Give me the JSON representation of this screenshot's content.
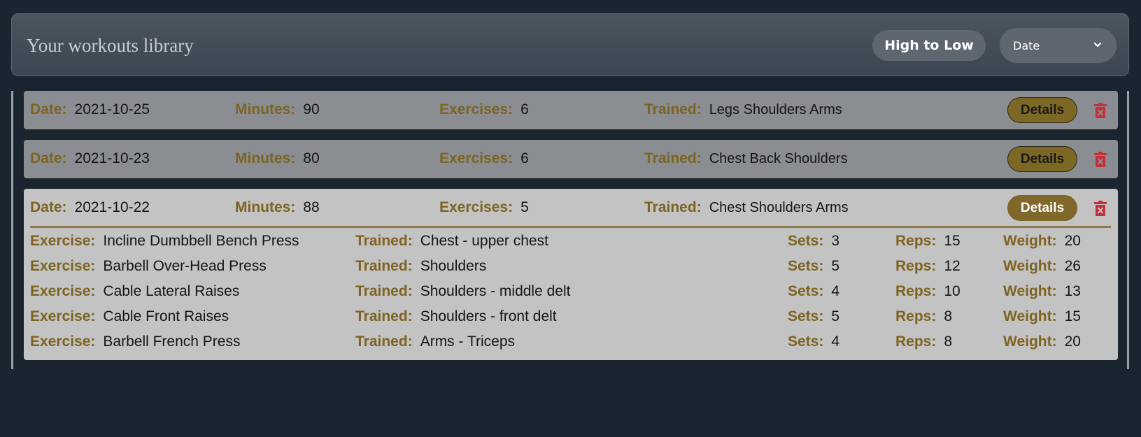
{
  "header": {
    "title": "Your workouts library",
    "sort_button": "High to Low",
    "sort_field": "Date"
  },
  "labels": {
    "date": "Date:",
    "minutes": "Minutes:",
    "exercises": "Exercises:",
    "trained": "Trained:",
    "details": "Details",
    "exercise": "Exercise:",
    "sets": "Sets:",
    "reps": "Reps:",
    "weight": "Weight:"
  },
  "workouts": [
    {
      "date": "2021-10-25",
      "minutes": "90",
      "exercises": "6",
      "trained": "Legs Shoulders Arms",
      "expanded": false
    },
    {
      "date": "2021-10-23",
      "minutes": "80",
      "exercises": "6",
      "trained": "Chest Back Shoulders",
      "expanded": false
    },
    {
      "date": "2021-10-22",
      "minutes": "88",
      "exercises": "5",
      "trained": "Chest Shoulders Arms",
      "expanded": true,
      "exercise_list": [
        {
          "name": "Incline Dumbbell Bench Press",
          "trained": "Chest - upper chest",
          "sets": "3",
          "reps": "15",
          "weight": "20"
        },
        {
          "name": "Barbell Over-Head Press",
          "trained": "Shoulders",
          "sets": "5",
          "reps": "12",
          "weight": "26"
        },
        {
          "name": "Cable Lateral Raises",
          "trained": "Shoulders - middle delt",
          "sets": "4",
          "reps": "10",
          "weight": "13"
        },
        {
          "name": "Cable Front Raises",
          "trained": "Shoulders - front delt",
          "sets": "5",
          "reps": "8",
          "weight": "15"
        },
        {
          "name": "Barbell French Press",
          "trained": "Arms - Triceps",
          "sets": "4",
          "reps": "8",
          "weight": "20"
        }
      ]
    }
  ],
  "colors": {
    "background": "#1a2530",
    "label_gold": "#7e6321",
    "button_gold": "#7c6824",
    "delete_red": "#c0313a"
  },
  "icons": {
    "sort_dropdown": "chevron-down-icon",
    "delete": "trash-icon"
  }
}
